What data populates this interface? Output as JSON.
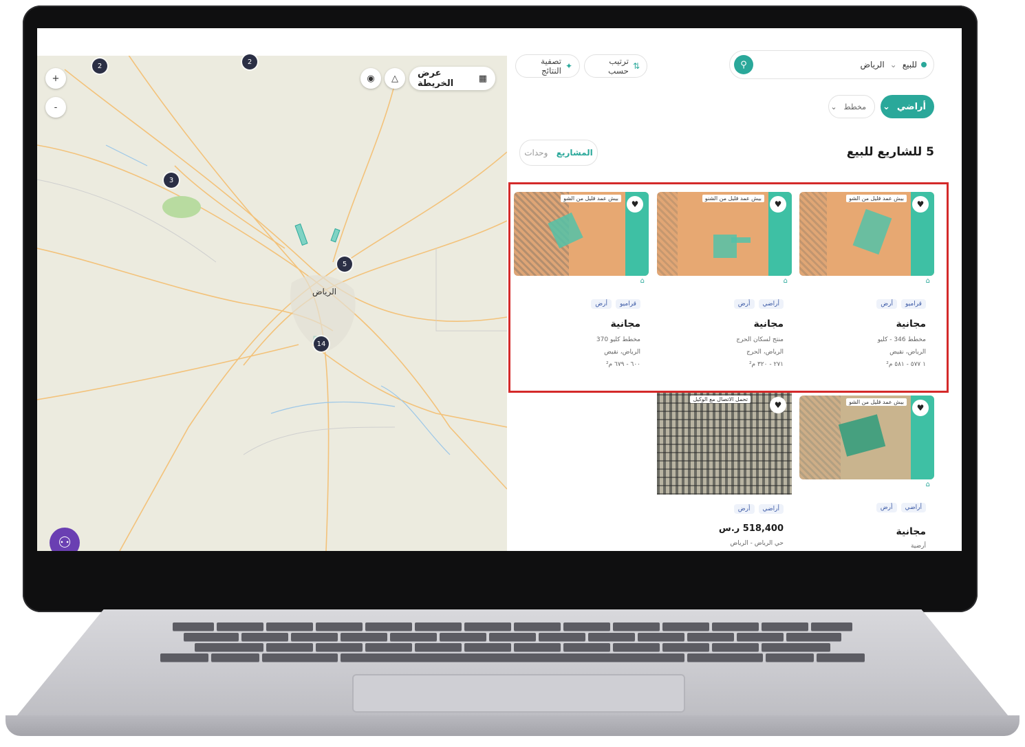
{
  "map": {
    "view_button_label": "عرض الخريطة",
    "zoom_in": "+",
    "zoom_out": "-",
    "city_label": "الرياض",
    "clusters": [
      "2",
      "2",
      "3",
      "5",
      "14"
    ],
    "access_icon": "accessibility-icon"
  },
  "panel": {
    "search": {
      "purpose": "للبيع",
      "city": "الرياض"
    },
    "sort_label": "ترتيب حسب",
    "filter_label": "تصفية النتائج",
    "type_chip": "أراضي",
    "sub_chip": "مخطط",
    "results_title": "5 للشاريع للبيع",
    "toggle": {
      "projects": "المشاريع",
      "units": "وحدات"
    },
    "cards": [
      {
        "banner": "بيش عمد قليل من الشو",
        "tags": [
          "قراميو",
          "أرض"
        ],
        "name": "مجانية",
        "line1": "مخطط 346 - كليو",
        "line2": "الرياض، نقيض",
        "line3": "١ ٥٧٧ - ٥٨١ م²"
      },
      {
        "banner": "بيش عمد قليل من الشنو",
        "tags": [
          "أراضي",
          "أرض"
        ],
        "name": "مجانية",
        "line1": "منتج لسكان الحرج",
        "line2": "الرياض، الحرج",
        "line3": "٢٧١ - ٣٢٠ م²"
      },
      {
        "banner": "بيش عمد قليل من الشو",
        "tags": [
          "قراميو",
          "أرض"
        ],
        "name": "مجانية",
        "line1": "مخطط كليو 370",
        "line2": "الرياض، نقيض",
        "line3": "٦٠٠ - ٦٧٩ م²"
      },
      {
        "banner": "بيش عمد قليل من الشو",
        "tags": [
          "أراضي",
          "أرض"
        ],
        "name": "مجانية",
        "line1": "أرضية"
      },
      {
        "banner": "تحمل الاتصال مع الوكيل",
        "tags": [
          "أراضي",
          "أرض"
        ],
        "price": "518,400 ر.س",
        "line1": "حي الرياض - الرياض"
      }
    ]
  },
  "colors": {
    "accent": "#2aa89a",
    "highlight": "#d42a2a",
    "cluster": "#2b2f45"
  }
}
